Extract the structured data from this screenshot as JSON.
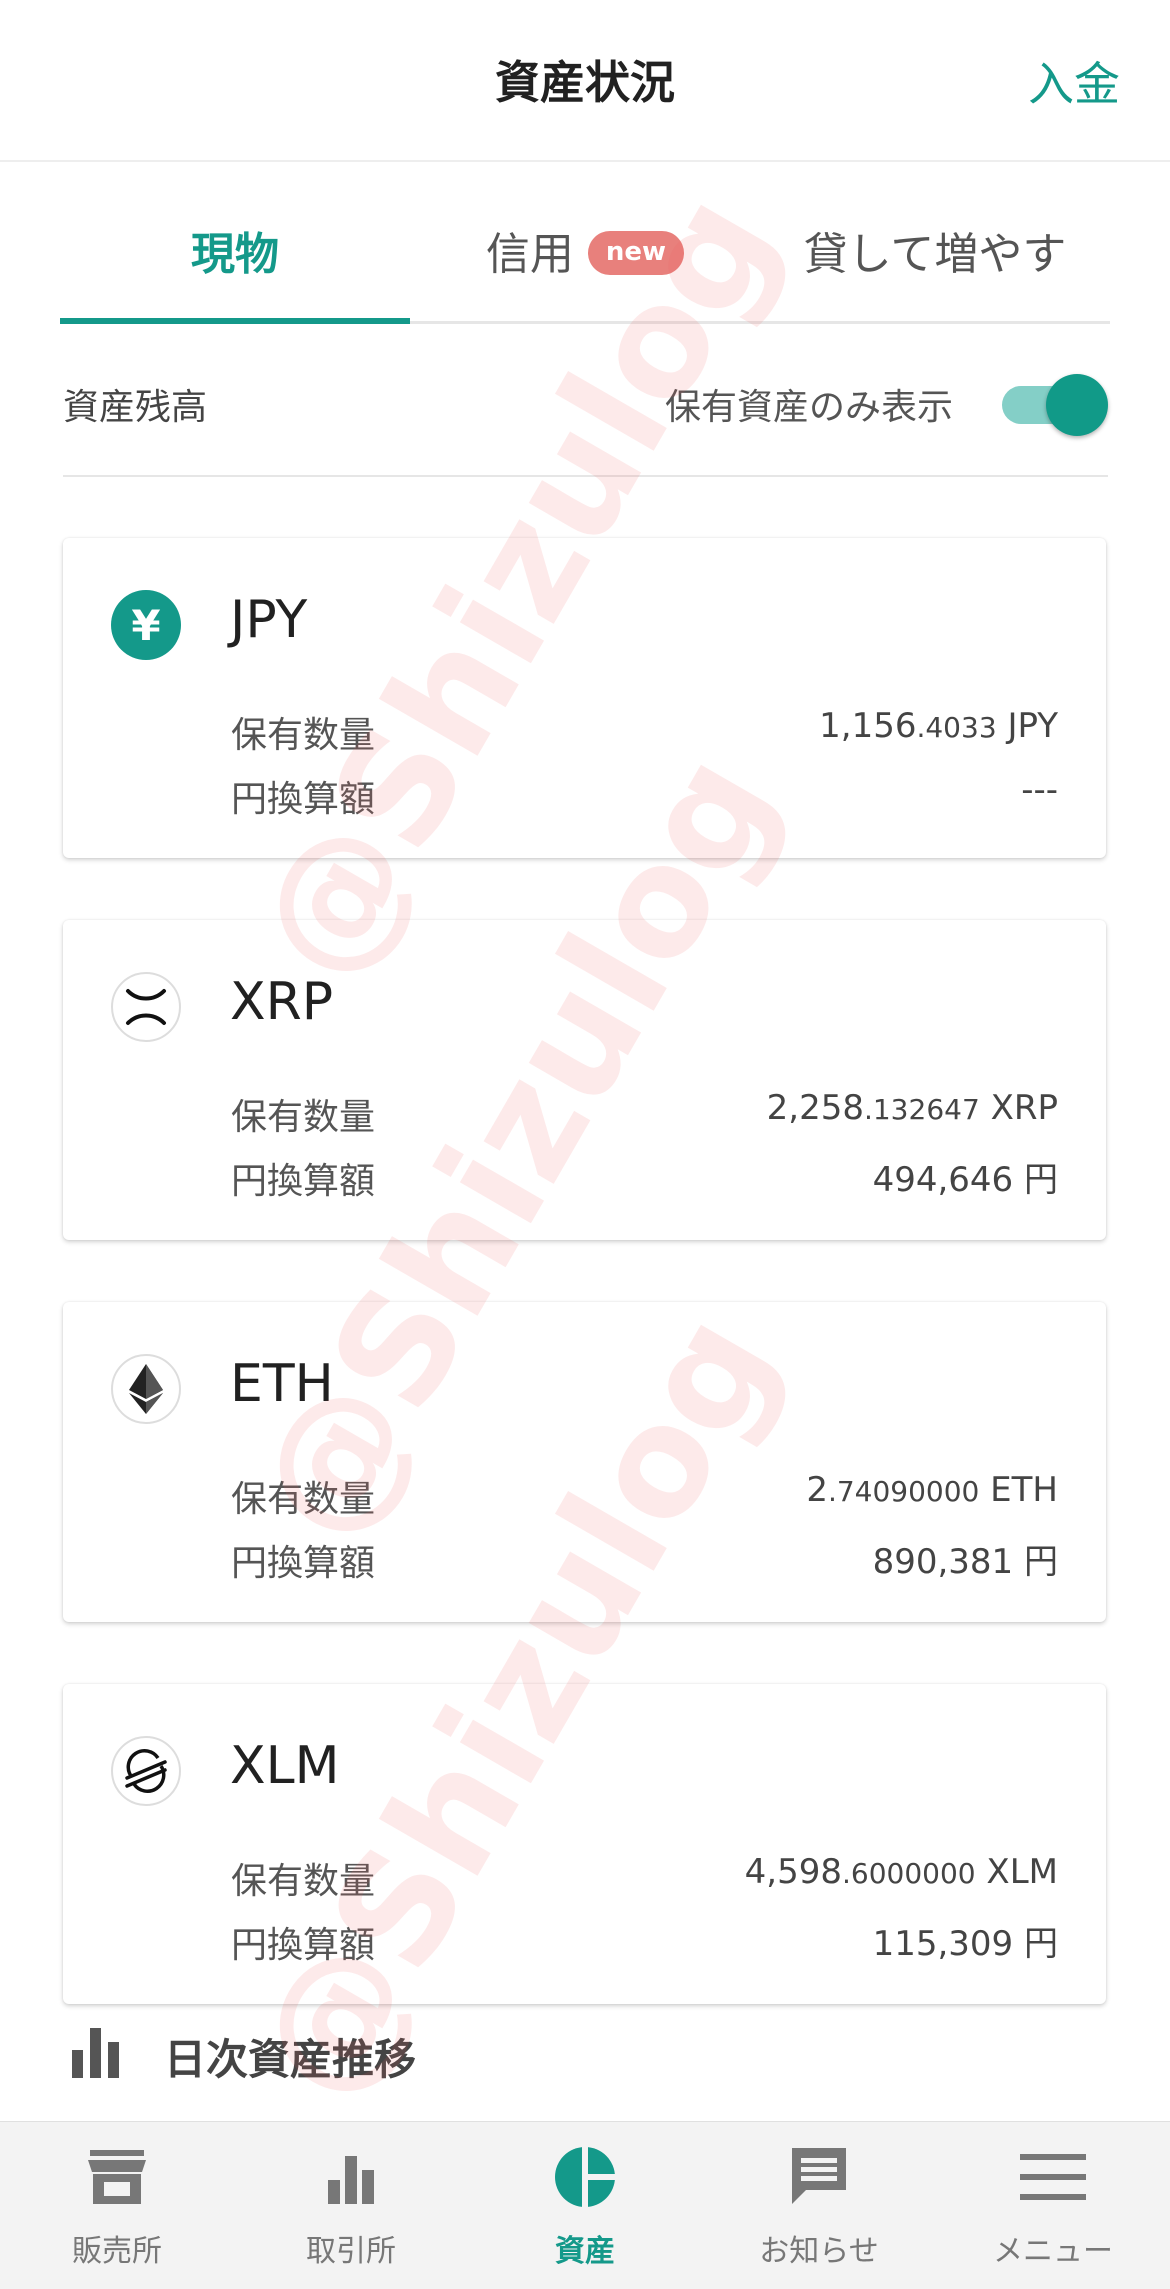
{
  "header": {
    "title": "資産状況",
    "action": "入金"
  },
  "tabs": [
    {
      "label": "現物",
      "active": true
    },
    {
      "label": "信用",
      "badge": "new",
      "active": false
    },
    {
      "label": "貸して増やす",
      "active": false
    }
  ],
  "balance": {
    "label": "資産残高",
    "holdings_only_label": "保有資産のみ表示",
    "holdings_only_on": true
  },
  "assets": [
    {
      "symbol": "JPY",
      "icon": "yen-icon",
      "icon_glyph": "¥",
      "qty_label": "保有数量",
      "qty_int": "1,156",
      "qty_dec": ".4033",
      "qty_unit": " JPY",
      "yen_label": "円換算額",
      "yen_value": "---"
    },
    {
      "symbol": "XRP",
      "icon": "xrp-icon",
      "qty_label": "保有数量",
      "qty_int": "2,258",
      "qty_dec": ".132647",
      "qty_unit": " XRP",
      "yen_label": "円換算額",
      "yen_value": "494,646 円"
    },
    {
      "symbol": "ETH",
      "icon": "eth-icon",
      "qty_label": "保有数量",
      "qty_int": "2",
      "qty_dec": ".74090000",
      "qty_unit": " ETH",
      "yen_label": "円換算額",
      "yen_value": "890,381 円"
    },
    {
      "symbol": "XLM",
      "icon": "xlm-icon",
      "qty_label": "保有数量",
      "qty_int": "4,598",
      "qty_dec": ".6000000",
      "qty_unit": " XLM",
      "yen_label": "円換算額",
      "yen_value": "115,309 円"
    }
  ],
  "section": {
    "title": "日次資産推移",
    "icon": "bar-chart-icon"
  },
  "nav": [
    {
      "label": "販売所",
      "icon": "shop-icon",
      "active": false
    },
    {
      "label": "取引所",
      "icon": "bar-chart-icon",
      "active": false
    },
    {
      "label": "資産",
      "icon": "pie-chart-icon",
      "active": true
    },
    {
      "label": "お知らせ",
      "icon": "message-icon",
      "active": false
    },
    {
      "label": "メニュー",
      "icon": "menu-icon",
      "active": false
    }
  ],
  "watermark": "@Shizulog",
  "colors": {
    "accent": "#14998a",
    "badge": "#e8807c",
    "watermark": "#f05a5a"
  }
}
